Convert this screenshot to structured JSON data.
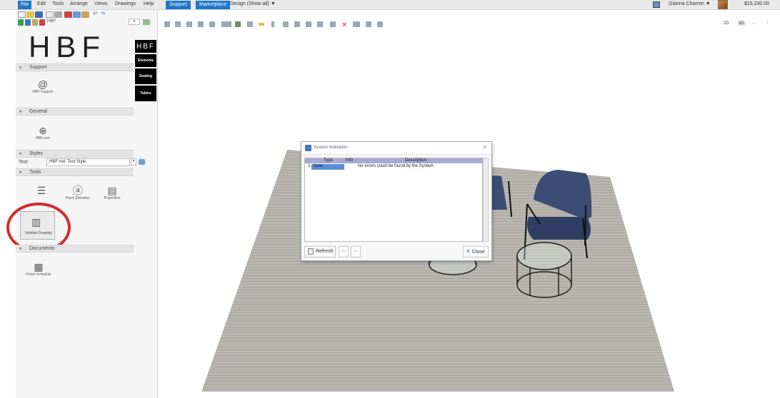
{
  "menu": {
    "file": "File",
    "items": [
      "Edit",
      "Tools",
      "Arrange",
      "Views",
      "Drawings",
      "Help"
    ],
    "support": "Support",
    "marketplace": "Marketplace",
    "design": "Design (Show all)",
    "design_arrow": "▼",
    "user": "Gianna Charron",
    "user_arrow": "▼",
    "price": "$15,230.00"
  },
  "left_panel": {
    "library": "HBF",
    "logo": "HBF",
    "side_tabs": [
      "HBF",
      "Elements",
      "Seating",
      "Tables"
    ],
    "sections": {
      "support": "Support",
      "general": "General",
      "styles": "Styles",
      "tools": "Tools",
      "documents": "Documents"
    },
    "support_items": [
      {
        "label": "HBF Support",
        "icon": "at-icon"
      }
    ],
    "general_items": [
      {
        "label": "HBF.com",
        "icon": "globe-icon"
      }
    ],
    "styles_row": {
      "label": "Text",
      "value": "HBF Ind. Text Style"
    },
    "tools_items": [
      {
        "label": "",
        "icon": "list-icon"
      },
      {
        "label": "Place Elevation",
        "icon": "elevation-icon"
      },
      {
        "label": "Properties",
        "icon": "properties-icon"
      },
      {
        "label": "Validate Drawing",
        "icon": "validate-icon"
      }
    ],
    "documents_items": [
      {
        "label": "Finish Schedule",
        "icon": "schedule-icon"
      }
    ]
  },
  "view_toggle": {
    "v2d": "2D",
    "v3d": "3D"
  },
  "dialog": {
    "title": "System Validation",
    "columns": [
      "Type",
      "Info",
      "Description"
    ],
    "rows": [
      {
        "num": "1",
        "type": "Note",
        "info": "",
        "description": "No errors could be found by the System."
      }
    ],
    "refresh": "Refresh",
    "close": "Close"
  },
  "colors": {
    "accent": "#1f78c8",
    "highlight_circle": "#d42a2a",
    "grid_header": "#a9a9d6"
  }
}
